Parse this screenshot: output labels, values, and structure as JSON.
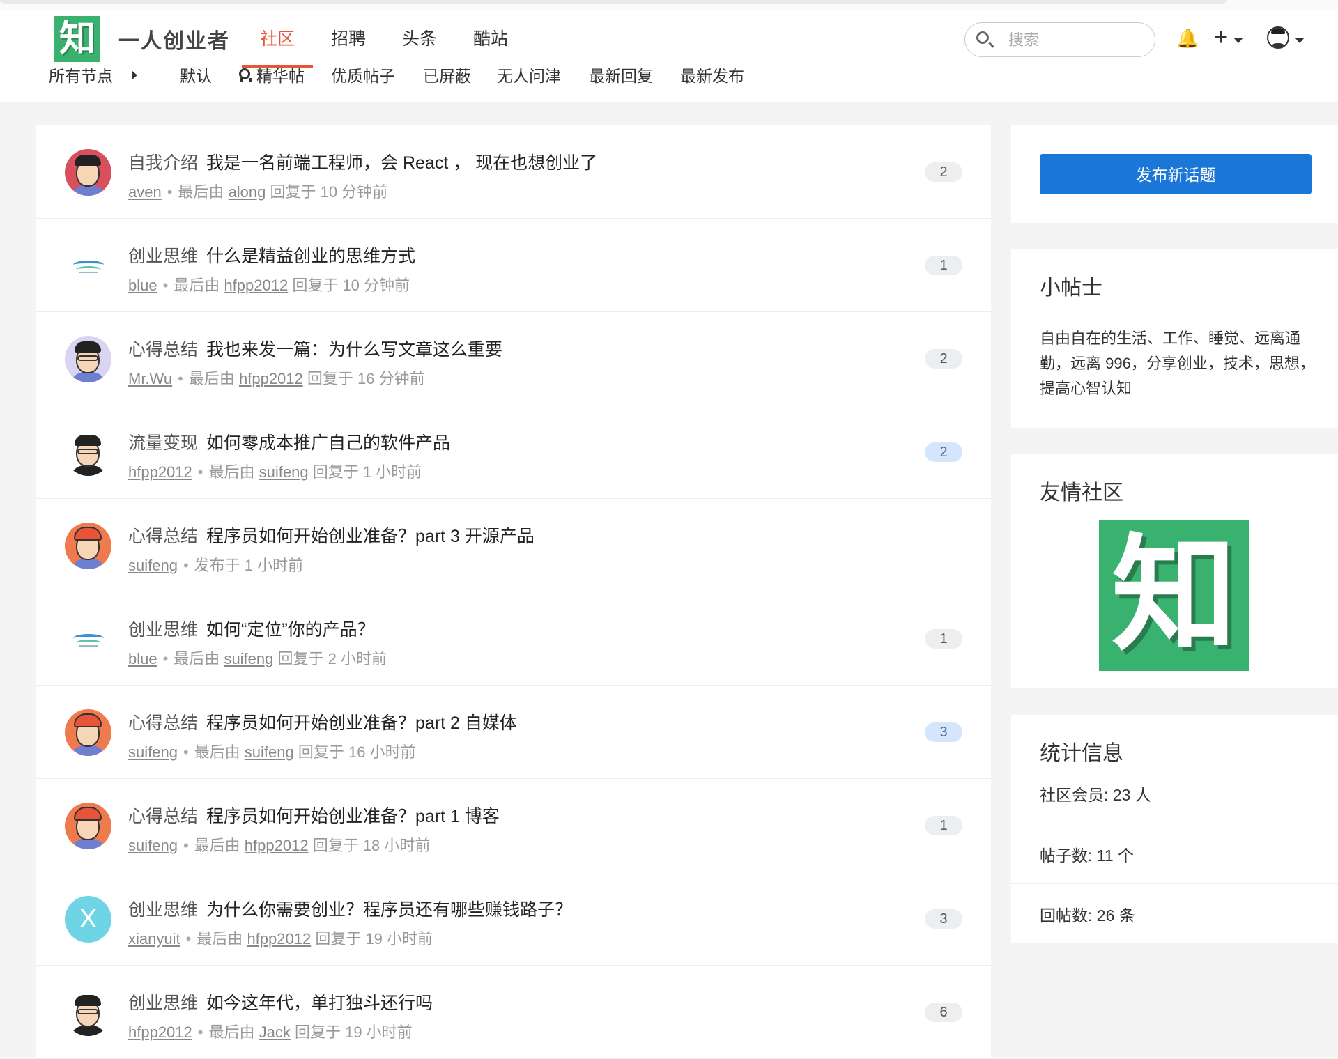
{
  "header": {
    "logo_char": "知",
    "brand": "一人创业者",
    "nav": [
      "社区",
      "招聘",
      "头条",
      "酷站"
    ],
    "active_nav": "社区",
    "search_placeholder": "搜索",
    "plus_symbol": "+",
    "bell_symbol": "🔔"
  },
  "subnav": {
    "all_nodes": "所有节点",
    "tabs": [
      "默认",
      "精华帖",
      "优质帖子",
      "已屏蔽",
      "无人问津",
      "最新回复",
      "最新发布"
    ]
  },
  "topics": [
    {
      "node": "自我介绍",
      "title": "我是一名前端工程师，会 React ， 现在也想创业了",
      "author": "aven",
      "prefix": "最后由",
      "last": "along",
      "time": "回复于 10 分钟前",
      "count": "2",
      "highlight": false,
      "avatar": "red"
    },
    {
      "node": "创业思维",
      "title": "什么是精益创业的思维方式",
      "author": "blue",
      "prefix": "最后由",
      "last": "hfpp2012",
      "time": "回复于 10 分钟前",
      "count": "1",
      "highlight": false,
      "avatar": "wave"
    },
    {
      "node": "心得总结",
      "title": "我也来发一篇：为什么写文章这么重要",
      "author": "Mr.Wu",
      "prefix": "最后由",
      "last": "hfpp2012",
      "time": "回复于 16 分钟前",
      "count": "2",
      "highlight": false,
      "avatar": "lilac"
    },
    {
      "node": "流量变现",
      "title": "如何零成本推广自己的软件产品",
      "author": "hfpp2012",
      "prefix": "最后由",
      "last": "suifeng",
      "time": "回复于 1 小时前",
      "count": "2",
      "highlight": true,
      "avatar": "glasses"
    },
    {
      "node": "心得总结",
      "title": "程序员如何开始创业准备？part 3 开源产品",
      "author": "suifeng",
      "prefix": "发布于 1 小时前",
      "last": "",
      "time": "",
      "count": "",
      "highlight": false,
      "avatar": "orange"
    },
    {
      "node": "创业思维",
      "title": "如何“定位”你的产品？",
      "author": "blue",
      "prefix": "最后由",
      "last": "suifeng",
      "time": "回复于 2 小时前",
      "count": "1",
      "highlight": false,
      "avatar": "wave"
    },
    {
      "node": "心得总结",
      "title": "程序员如何开始创业准备？part 2 自媒体",
      "author": "suifeng",
      "prefix": "最后由",
      "last": "suifeng",
      "time": "回复于 16 小时前",
      "count": "3",
      "highlight": true,
      "avatar": "orange"
    },
    {
      "node": "心得总结",
      "title": "程序员如何开始创业准备？part 1 博客",
      "author": "suifeng",
      "prefix": "最后由",
      "last": "hfpp2012",
      "time": "回复于 18 小时前",
      "count": "1",
      "highlight": false,
      "avatar": "orange"
    },
    {
      "node": "创业思维",
      "title": "为什么你需要创业？程序员还有哪些赚钱路子？",
      "author": "xianyuit",
      "prefix": "最后由",
      "last": "hfpp2012",
      "time": "回复于 19 小时前",
      "count": "3",
      "highlight": false,
      "avatar": "letter",
      "avatar_letter": "X"
    },
    {
      "node": "创业思维",
      "title": "如今这年代，单打独斗还行吗",
      "author": "hfpp2012",
      "prefix": "最后由",
      "last": "Jack",
      "time": "回复于 19 小时前",
      "count": "6",
      "highlight": false,
      "avatar": "glasses"
    }
  ],
  "sidebar": {
    "new_topic": "发布新话题",
    "tips_title": "小帖士",
    "tips_text": "自由自在的生活、工作、睡觉、远离通勤，远离 996，分享创业，技术，思想，提高心智认知",
    "friends_title": "友情社区",
    "friends_logo_char": "知",
    "stats_title": "统计信息",
    "members": "社区会员: 23 人",
    "posts": "帖子数: 11 个",
    "replies": "回帖数: 26 条"
  },
  "colors": {
    "accent": "#e8543a",
    "primary_button": "#1a77d8",
    "logo_green": "#3ab26f"
  }
}
